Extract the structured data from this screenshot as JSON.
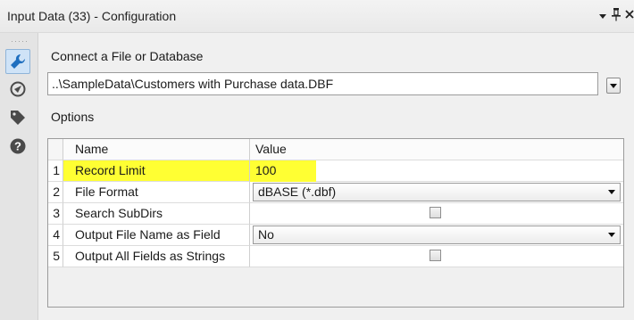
{
  "window": {
    "title": "Input Data (33) - Configuration",
    "dropdown_glyph": "▾",
    "pin_glyph": "📌",
    "close_glyph": "✕"
  },
  "sidebar": {
    "items": [
      {
        "icon": "wrench-icon",
        "active": true
      },
      {
        "icon": "navigate-icon",
        "active": false
      },
      {
        "icon": "tag-icon",
        "active": false
      },
      {
        "icon": "help-icon",
        "active": false
      }
    ]
  },
  "main": {
    "connect_label": "Connect a File or Database",
    "file_path": "..\\SampleData\\Customers with Purchase data.DBF",
    "options_label": "Options",
    "grid": {
      "headers": {
        "name": "Name",
        "value": "Value"
      },
      "rows": [
        {
          "num": "1",
          "name": "Record Limit",
          "value": "100",
          "highlight": true
        },
        {
          "num": "2",
          "name": "File Format",
          "value": "dBASE (*.dbf)"
        },
        {
          "num": "3",
          "name": "Search SubDirs",
          "checked": false
        },
        {
          "num": "4",
          "name": "Output File Name as Field",
          "value": "No"
        },
        {
          "num": "5",
          "name": "Output All Fields as Strings",
          "checked": false
        }
      ]
    }
  },
  "colors": {
    "highlight": "#ffff33",
    "active_icon": "#1f6fbf",
    "icon": "#4a4a4a"
  }
}
